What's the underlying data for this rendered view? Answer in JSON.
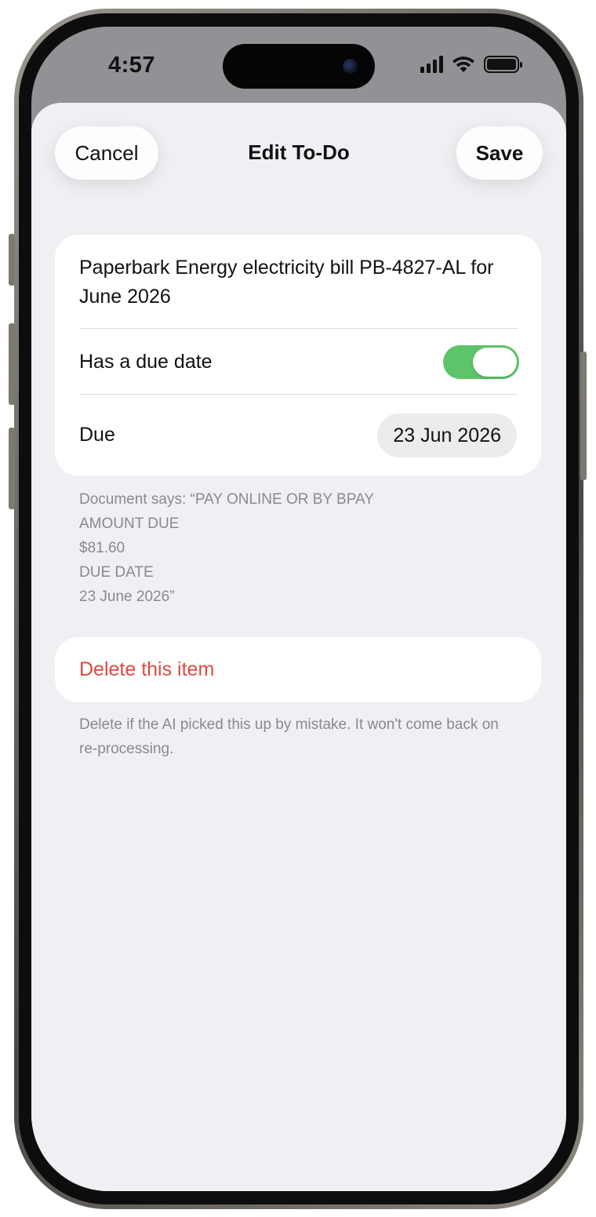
{
  "status_bar": {
    "time": "4:57",
    "icons": [
      "cellular-signal-icon",
      "wifi-icon",
      "battery-icon"
    ]
  },
  "nav": {
    "cancel_label": "Cancel",
    "title": "Edit To-Do",
    "save_label": "Save"
  },
  "todo": {
    "title": "Paperbark Energy electricity bill PB-4827-AL for June 2026",
    "has_due_date_label": "Has a due date",
    "has_due_date": true,
    "due_label": "Due",
    "due_value": "23 Jun 2026"
  },
  "document_note": {
    "lines": [
      "Document says: “PAY ONLINE OR BY BPAY",
      "AMOUNT DUE",
      "$81.60",
      "DUE DATE",
      "23 June 2026”"
    ]
  },
  "delete": {
    "label": "Delete this item",
    "note": "Delete if the AI picked this up by mistake. It won't come back on re-processing."
  },
  "colors": {
    "toggle_on": "#5ec469",
    "destructive": "#de4a3f",
    "sheet_background": "#f0f0f4",
    "secondary_text": "#8a8a8e"
  }
}
